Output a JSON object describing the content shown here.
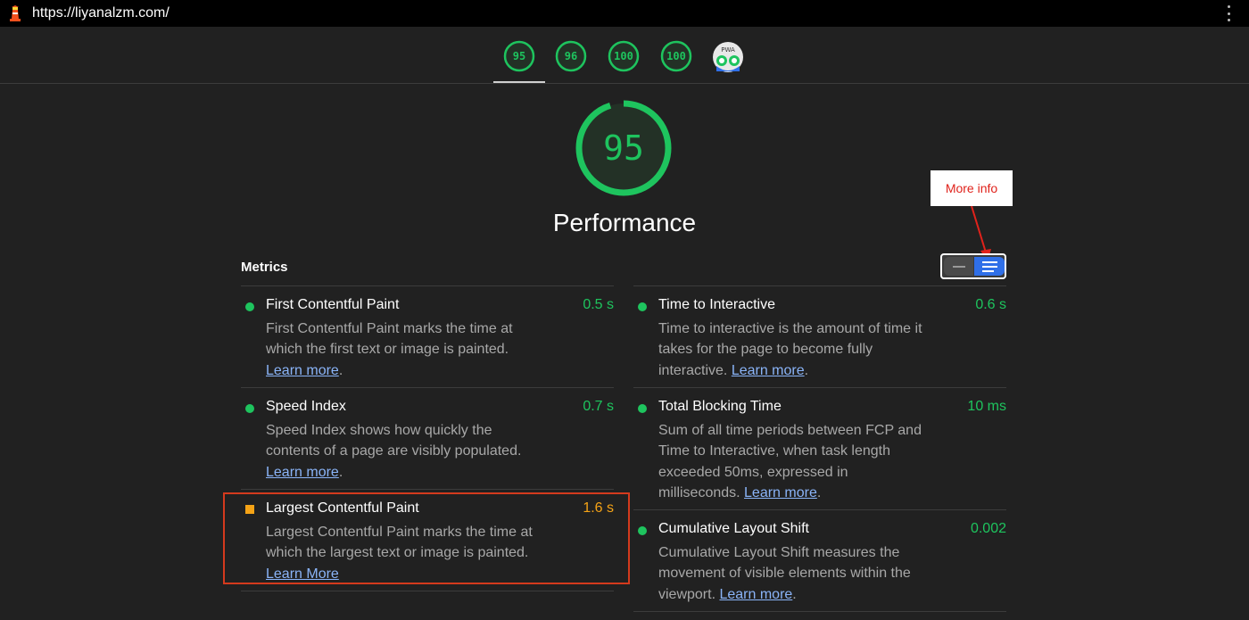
{
  "browser": {
    "url": "https://liyanalzm.com/",
    "logo_icon": "lighthouse-icon",
    "menu_icon": "kebab-menu-icon"
  },
  "category_tabs": [
    {
      "score": "95",
      "active": true
    },
    {
      "score": "96",
      "active": false
    },
    {
      "score": "100",
      "active": false
    },
    {
      "score": "100",
      "active": false
    },
    {
      "label": "PWA",
      "icon": "pwa-badge-icon",
      "active": false
    }
  ],
  "gauge": {
    "score": "95",
    "title": "Performance",
    "fill_fraction": 0.95,
    "color": "#1ec45e"
  },
  "annotation": {
    "label": "More info",
    "color": "#e0221b"
  },
  "metrics": {
    "title": "Metrics",
    "toggle": {
      "compact_icon": "collapsed-view-icon",
      "expanded_icon": "expanded-view-icon",
      "active": "expanded"
    },
    "left": [
      {
        "name": "First Contentful Paint",
        "value": "0.5 s",
        "status": "pass",
        "desc_lines": [
          "First Contentful Paint marks the time at",
          "which the first text or image is painted."
        ],
        "link_prefix": "",
        "link": "Learn more",
        "link_suffix": "."
      },
      {
        "name": "Speed Index",
        "value": "0.7 s",
        "status": "pass",
        "desc_lines": [
          "Speed Index shows how quickly the",
          "contents of a page are visibly populated."
        ],
        "link_prefix": "",
        "link": "Learn more",
        "link_suffix": "."
      },
      {
        "name": "Largest Contentful Paint",
        "value": "1.6 s",
        "status": "average",
        "desc_lines": [
          "Largest Contentful Paint marks the time at",
          "which the largest text or image is painted."
        ],
        "link_prefix": "",
        "link": "Learn More",
        "link_suffix": ""
      }
    ],
    "right": [
      {
        "name": "Time to Interactive",
        "value": "0.6 s",
        "status": "pass",
        "desc_lines": [
          "Time to interactive is the amount of time it",
          "takes for the page to become fully"
        ],
        "link_prefix": "interactive. ",
        "link": "Learn more",
        "link_suffix": "."
      },
      {
        "name": "Total Blocking Time",
        "value": "10 ms",
        "status": "pass",
        "desc_lines": [
          "Sum of all time periods between FCP and",
          "Time to Interactive, when task length",
          "exceeded 50ms, expressed in"
        ],
        "link_prefix": "milliseconds. ",
        "link": "Learn more",
        "link_suffix": "."
      },
      {
        "name": "Cumulative Layout Shift",
        "value": "0.002",
        "status": "pass",
        "desc_lines": [
          "Cumulative Layout Shift measures the",
          "movement of visible elements within the"
        ],
        "link_prefix": "viewport. ",
        "link": "Learn more",
        "link_suffix": "."
      }
    ]
  },
  "colors": {
    "pass": "#1ec45e",
    "average": "#f5a316",
    "link": "#8ab4f8",
    "highlight": "#d43a1d"
  }
}
